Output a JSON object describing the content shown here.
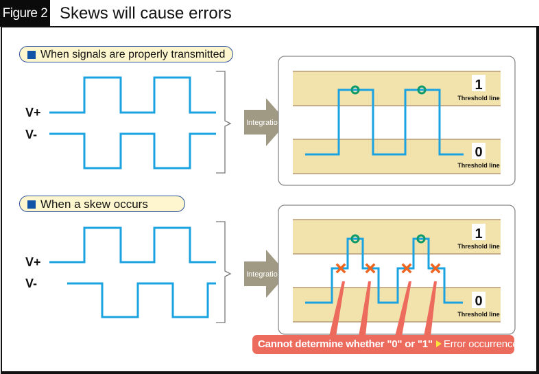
{
  "figure": {
    "tag": "Figure 2",
    "title": "Skews will cause errors"
  },
  "sections": [
    {
      "id": "proper",
      "label": "When signals are properly transmitted",
      "signals": {
        "v_plus": "V+",
        "v_minus": "V-"
      },
      "arrow_label": "Integration",
      "thresholds": [
        {
          "level": "1",
          "caption": "Threshold line"
        },
        {
          "level": "0",
          "caption": "Threshold line"
        }
      ],
      "markers": {
        "circle_count": 2,
        "cross_count": 0
      }
    },
    {
      "id": "skew",
      "label": "When a skew occurs",
      "signals": {
        "v_plus": "V+",
        "v_minus": "V-"
      },
      "arrow_label": "Integration",
      "thresholds": [
        {
          "level": "1",
          "caption": "Threshold line"
        },
        {
          "level": "0",
          "caption": "Threshold line"
        }
      ],
      "markers": {
        "circle_count": 2,
        "cross_count": 4
      }
    }
  ],
  "error_banner": {
    "text": "Cannot determine whether \"0\" or \"1\"",
    "result": "Error occurrence"
  },
  "colors": {
    "signal": "#1aa3e0",
    "band": "#f2e2ab",
    "band_edge": "#b89a74",
    "ok_marker": "#0e9a6a",
    "error_marker": "#ee6522",
    "arrow": "#a09a84",
    "error_banner": "#ec6b5c",
    "pill_fill": "#fdf6cf",
    "pill_border": "#2a4f9c"
  }
}
